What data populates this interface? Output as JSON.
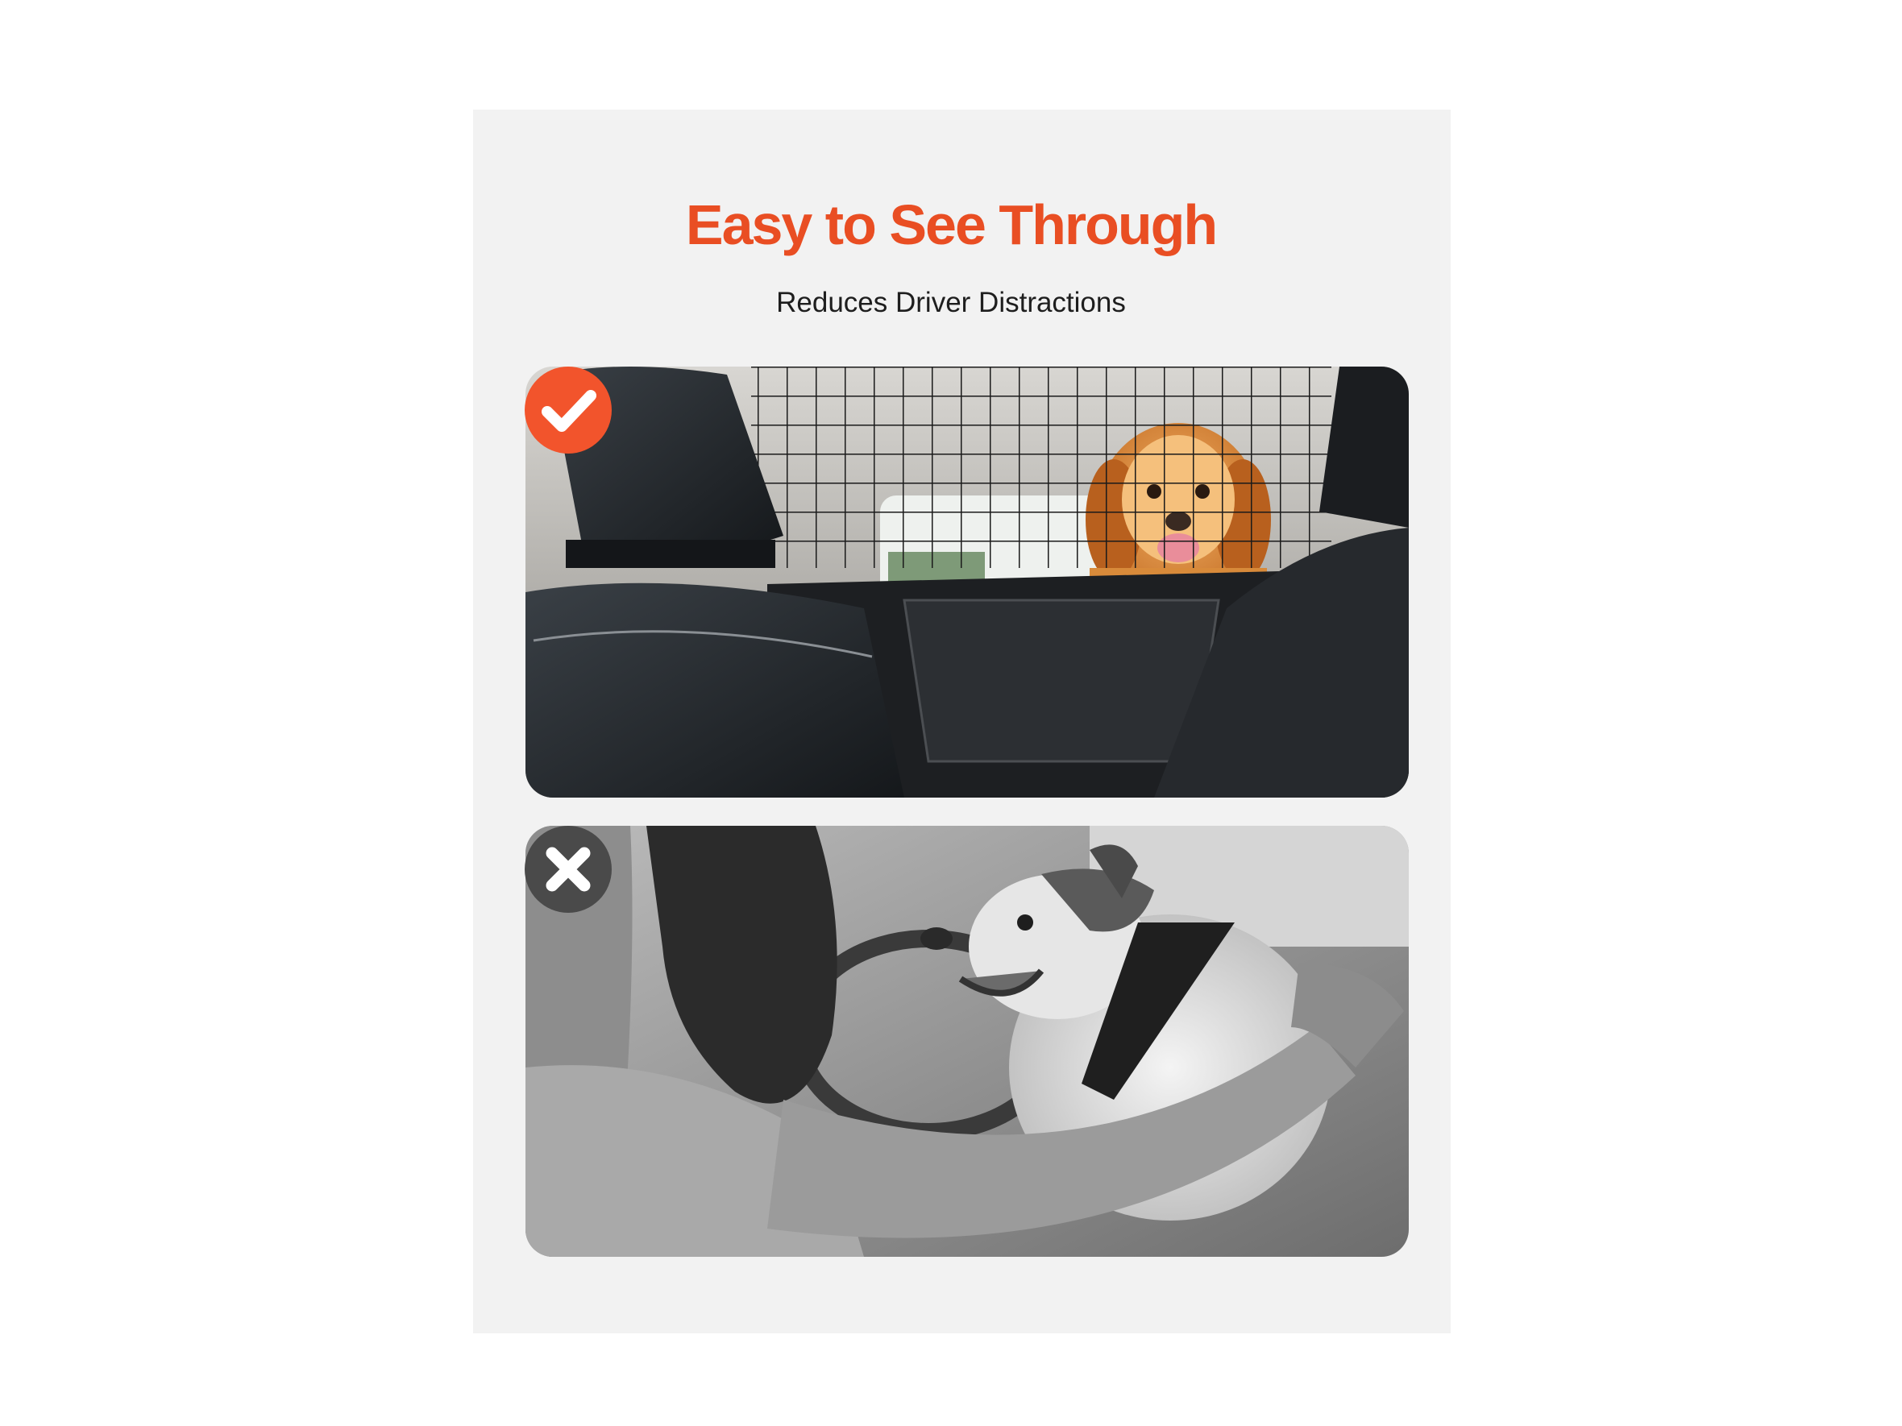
{
  "header": {
    "title": "Easy to See Through",
    "subtitle": "Reduces Driver Distractions"
  },
  "comparison": {
    "good": {
      "badge_icon": "check-icon",
      "badge_color": "#f2542c",
      "image": "dog-behind-barrier-photo"
    },
    "bad": {
      "badge_icon": "cross-icon",
      "badge_color": "#4a4a4a",
      "image": "dog-on-driver-lap-photo"
    }
  },
  "colors": {
    "accent": "#e94e23",
    "background": "#f2f2f2",
    "text": "#1e1e1e"
  }
}
